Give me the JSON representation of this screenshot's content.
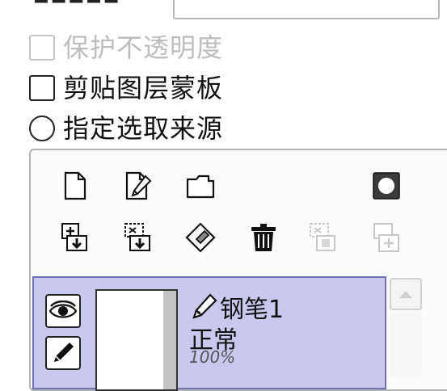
{
  "options": {
    "protect_opacity": {
      "label": "保护不透明度",
      "checked": false,
      "disabled": true
    },
    "clip_layer_mask": {
      "label": "剪贴图层蒙板",
      "checked": false,
      "disabled": false
    },
    "selection_source": {
      "label": "指定选取来源",
      "selected": false,
      "disabled": false
    }
  },
  "toolbar": {
    "row1": [
      "new-layer-icon",
      "new-pen-layer-icon",
      "new-folder-icon",
      "layer-mask-icon"
    ],
    "row2": [
      "merge-down-icon",
      "paste-selection-icon",
      "clear-layer-icon",
      "delete-layer-icon",
      "cut-merge-icon",
      "copy-layer-icon"
    ]
  },
  "layer": {
    "name": "钢笔1",
    "mode": "正常",
    "opacity": "100%"
  },
  "colors": {
    "selected_row": "#c9c9f0",
    "selected_border": "#7070b4",
    "disabled_text": "#bdbdbd"
  }
}
